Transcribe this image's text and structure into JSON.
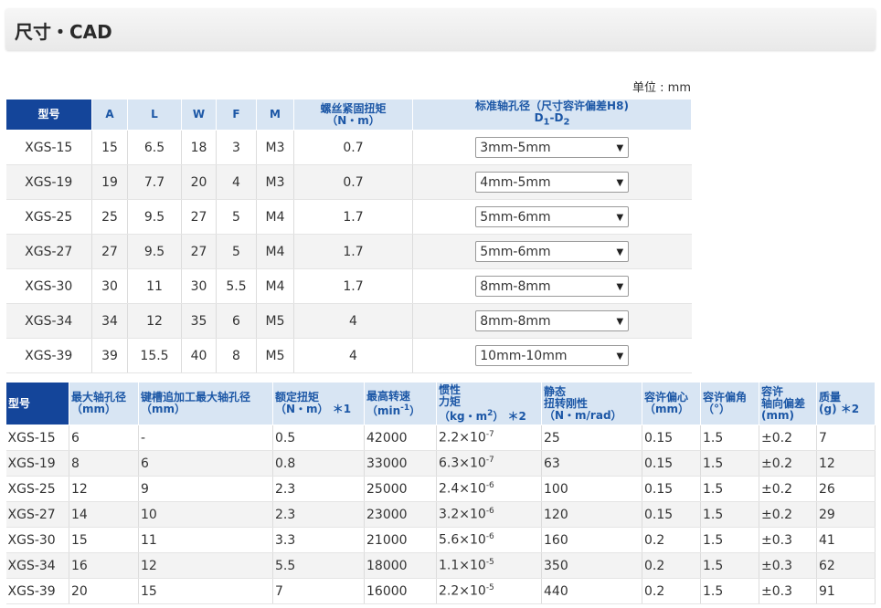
{
  "page": {
    "title": "尺寸・CAD",
    "unit": "单位 : mm"
  },
  "table1": {
    "headers": {
      "model": "型号",
      "a": "A",
      "l": "L",
      "w": "W",
      "f": "F",
      "m": "M",
      "torque_line1": "螺丝紧固扭矩",
      "torque_line2": "（N・m）",
      "bore_line1": "标准轴孔径（尺寸容许偏差H8)",
      "bore_d1": "D",
      "bore_sub1": "1",
      "bore_dash": "-D",
      "bore_sub2": "2"
    },
    "rows": [
      {
        "model": "XGS-15",
        "a": "15",
        "l": "6.5",
        "w": "18",
        "f": "3",
        "m": "M3",
        "torque": "0.7",
        "bore": "3mm-5mm"
      },
      {
        "model": "XGS-19",
        "a": "19",
        "l": "7.7",
        "w": "20",
        "f": "4",
        "m": "M3",
        "torque": "0.7",
        "bore": "4mm-5mm"
      },
      {
        "model": "XGS-25",
        "a": "25",
        "l": "9.5",
        "w": "27",
        "f": "5",
        "m": "M4",
        "torque": "1.7",
        "bore": "5mm-6mm"
      },
      {
        "model": "XGS-27",
        "a": "27",
        "l": "9.5",
        "w": "27",
        "f": "5",
        "m": "M4",
        "torque": "1.7",
        "bore": "5mm-6mm"
      },
      {
        "model": "XGS-30",
        "a": "30",
        "l": "11",
        "w": "30",
        "f": "5.5",
        "m": "M4",
        "torque": "1.7",
        "bore": "8mm-8mm"
      },
      {
        "model": "XGS-34",
        "a": "34",
        "l": "12",
        "w": "35",
        "f": "6",
        "m": "M5",
        "torque": "4",
        "bore": "8mm-8mm"
      },
      {
        "model": "XGS-39",
        "a": "39",
        "l": "15.5",
        "w": "40",
        "f": "8",
        "m": "M5",
        "torque": "4",
        "bore": "10mm-10mm"
      }
    ],
    "dropdown_arrow": "▼"
  },
  "table2": {
    "headers": {
      "model": "型号",
      "maxbore_1": "最大轴孔径",
      "maxbore_2": "（mm）",
      "keyway_1": "键槽追加工最大轴孔径",
      "keyway_2": "（mm）",
      "rated_1": "额定扭矩",
      "rated_2": "（N・m）",
      "rated_note": "＊1",
      "speed_1": "最高转速",
      "speed_2": "（min",
      "speed_sup": "-1",
      "speed_3": "）",
      "inertia_1": "惯性",
      "inertia_2": "力矩",
      "inertia_3": "（kg・m",
      "inertia_sup": "2",
      "inertia_4": "）",
      "inertia_note": "＊2",
      "stiff_1": "静态",
      "stiff_2": "扭转刚性",
      "stiff_3": "（N・m/rad）",
      "ecc_1": "容许偏心",
      "ecc_2": "（mm）",
      "ang_1": "容许偏角",
      "ang_2": "（°）",
      "axial_1": "容许",
      "axial_2": "轴向偏差",
      "axial_3": "(mm)",
      "mass_1": "质量",
      "mass_2": "(g)",
      "mass_note": "＊2"
    },
    "rows": [
      {
        "model": "XGS-15",
        "maxbore": "6",
        "keyway": "-",
        "rated": "0.5",
        "speed": "42000",
        "inertia_base": "2.2×10",
        "inertia_exp": "-7",
        "stiff": "25",
        "ecc": "0.15",
        "ang": "1.5",
        "axial": "±0.2",
        "mass": "7"
      },
      {
        "model": "XGS-19",
        "maxbore": "8",
        "keyway": "6",
        "rated": "0.8",
        "speed": "33000",
        "inertia_base": "6.3×10",
        "inertia_exp": "-7",
        "stiff": "63",
        "ecc": "0.15",
        "ang": "1.5",
        "axial": "±0.2",
        "mass": "12"
      },
      {
        "model": "XGS-25",
        "maxbore": "12",
        "keyway": "9",
        "rated": "2.3",
        "speed": "25000",
        "inertia_base": "2.4×10",
        "inertia_exp": "-6",
        "stiff": "100",
        "ecc": "0.15",
        "ang": "1.5",
        "axial": "±0.2",
        "mass": "26"
      },
      {
        "model": "XGS-27",
        "maxbore": "14",
        "keyway": "10",
        "rated": "2.3",
        "speed": "23000",
        "inertia_base": "3.2×10",
        "inertia_exp": "-6",
        "stiff": "120",
        "ecc": "0.15",
        "ang": "1.5",
        "axial": "±0.2",
        "mass": "29"
      },
      {
        "model": "XGS-30",
        "maxbore": "15",
        "keyway": "11",
        "rated": "3.3",
        "speed": "21000",
        "inertia_base": "5.6×10",
        "inertia_exp": "-6",
        "stiff": "160",
        "ecc": "0.2",
        "ang": "1.5",
        "axial": "±0.3",
        "mass": "41"
      },
      {
        "model": "XGS-34",
        "maxbore": "16",
        "keyway": "12",
        "rated": "5.5",
        "speed": "18000",
        "inertia_base": "1.1×10",
        "inertia_exp": "-5",
        "stiff": "350",
        "ecc": "0.2",
        "ang": "1.5",
        "axial": "±0.3",
        "mass": "62"
      },
      {
        "model": "XGS-39",
        "maxbore": "20",
        "keyway": "15",
        "rated": "7",
        "speed": "16000",
        "inertia_base": "2.2×10",
        "inertia_exp": "-5",
        "stiff": "440",
        "ecc": "0.2",
        "ang": "1.5",
        "axial": "±0.3",
        "mass": "91"
      }
    ]
  }
}
